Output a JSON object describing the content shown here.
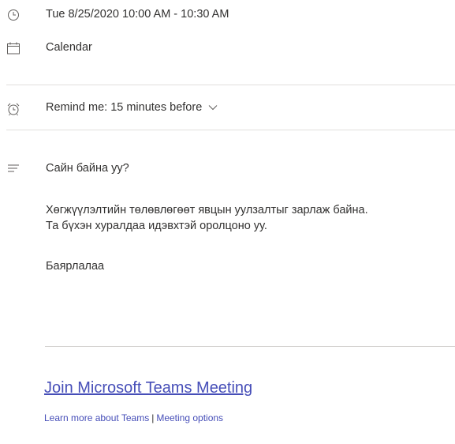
{
  "event": {
    "datetime": "Tue 8/25/2020 10:00 AM - 10:30 AM",
    "calendar": "Calendar",
    "reminder": "Remind me: 15 minutes before"
  },
  "body": {
    "greeting": "Сайн байна уу?",
    "line1": "Хөгжүүлэлтийн төлөвлөгөөт явцын уулзалтыг зарлаж байна.",
    "line2": "Та бүхэн хуралдаа идэвхтэй оролцоно уу.",
    "signoff": "Баярлалаа"
  },
  "teams": {
    "join_label": "Join Microsoft Teams Meeting",
    "learn_more": "Learn more about Teams",
    "separator": "|",
    "options": "Meeting options"
  },
  "icons": {
    "time": "clock-icon",
    "calendar": "calendar-icon",
    "reminder": "alarm-clock-icon",
    "description": "text-lines-icon",
    "dropdown": "chevron-down-icon"
  },
  "colors": {
    "link": "#464eb8",
    "text": "#323130",
    "icon": "#605e5c",
    "divider": "#e1dfdd"
  }
}
